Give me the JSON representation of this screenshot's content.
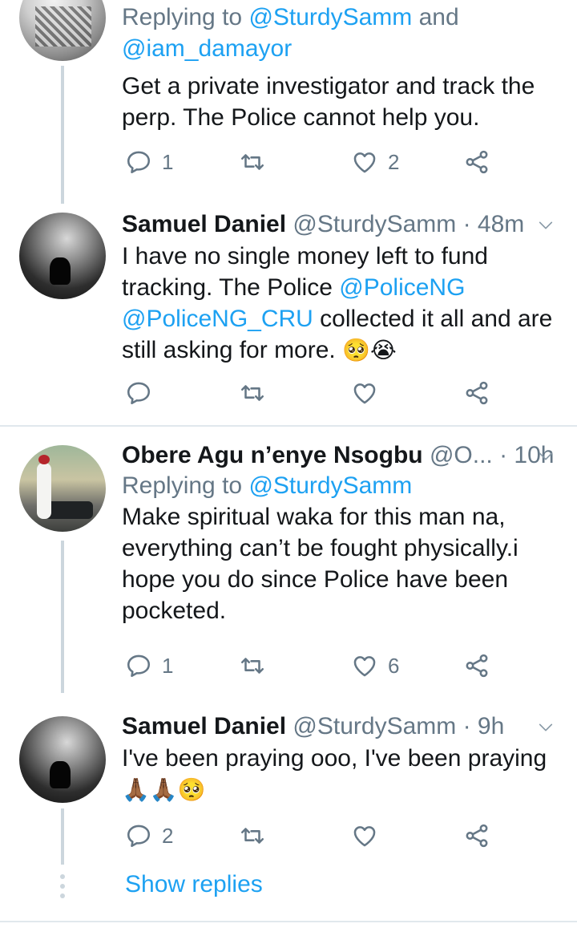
{
  "tweets": [
    {
      "replying_prefix": "Replying to ",
      "replying_to": "@SturdySamm",
      "replying_and": " and",
      "replying_to2": "@iam_damayor",
      "text": "Get a private investigator and track the perp. The Police cannot help you.",
      "reply_count": "1",
      "like_count": "2"
    },
    {
      "name": "Samuel Daniel",
      "handle": "@SturdySamm",
      "time": "· 48m",
      "text_1": "I have no single money left to fund tracking. The Police ",
      "mention_1": "@PoliceNG",
      "mention_2": "@PoliceNG_CRU",
      "text_2": " collected it all and are still asking for more. ",
      "emoji": "🥺😭"
    },
    {
      "name": "Obere Agu n’enye Nsogbu",
      "handle": "@O...",
      "time": "· 10h",
      "replying_prefix": "Replying to ",
      "replying_to": "@SturdySamm",
      "text": "Make spiritual waka for this man na, everything can’t be fought physically.i hope you do since Police have been pocketed.",
      "reply_count": "1",
      "like_count": "6"
    },
    {
      "name": "Samuel Daniel",
      "handle": "@SturdySamm",
      "time": "· 9h",
      "text": "I've been praying ooo, I've been praying",
      "emoji": "🙏🏾🙏🏾🥺",
      "reply_count": "2"
    }
  ],
  "show_replies": "Show replies",
  "colors": {
    "link": "#1da1f2",
    "muted": "#657786",
    "text": "#14171a",
    "divider": "#e1e8ed"
  },
  "icons": [
    "reply-icon",
    "retweet-icon",
    "like-icon",
    "share-icon",
    "chevron-down-icon"
  ]
}
